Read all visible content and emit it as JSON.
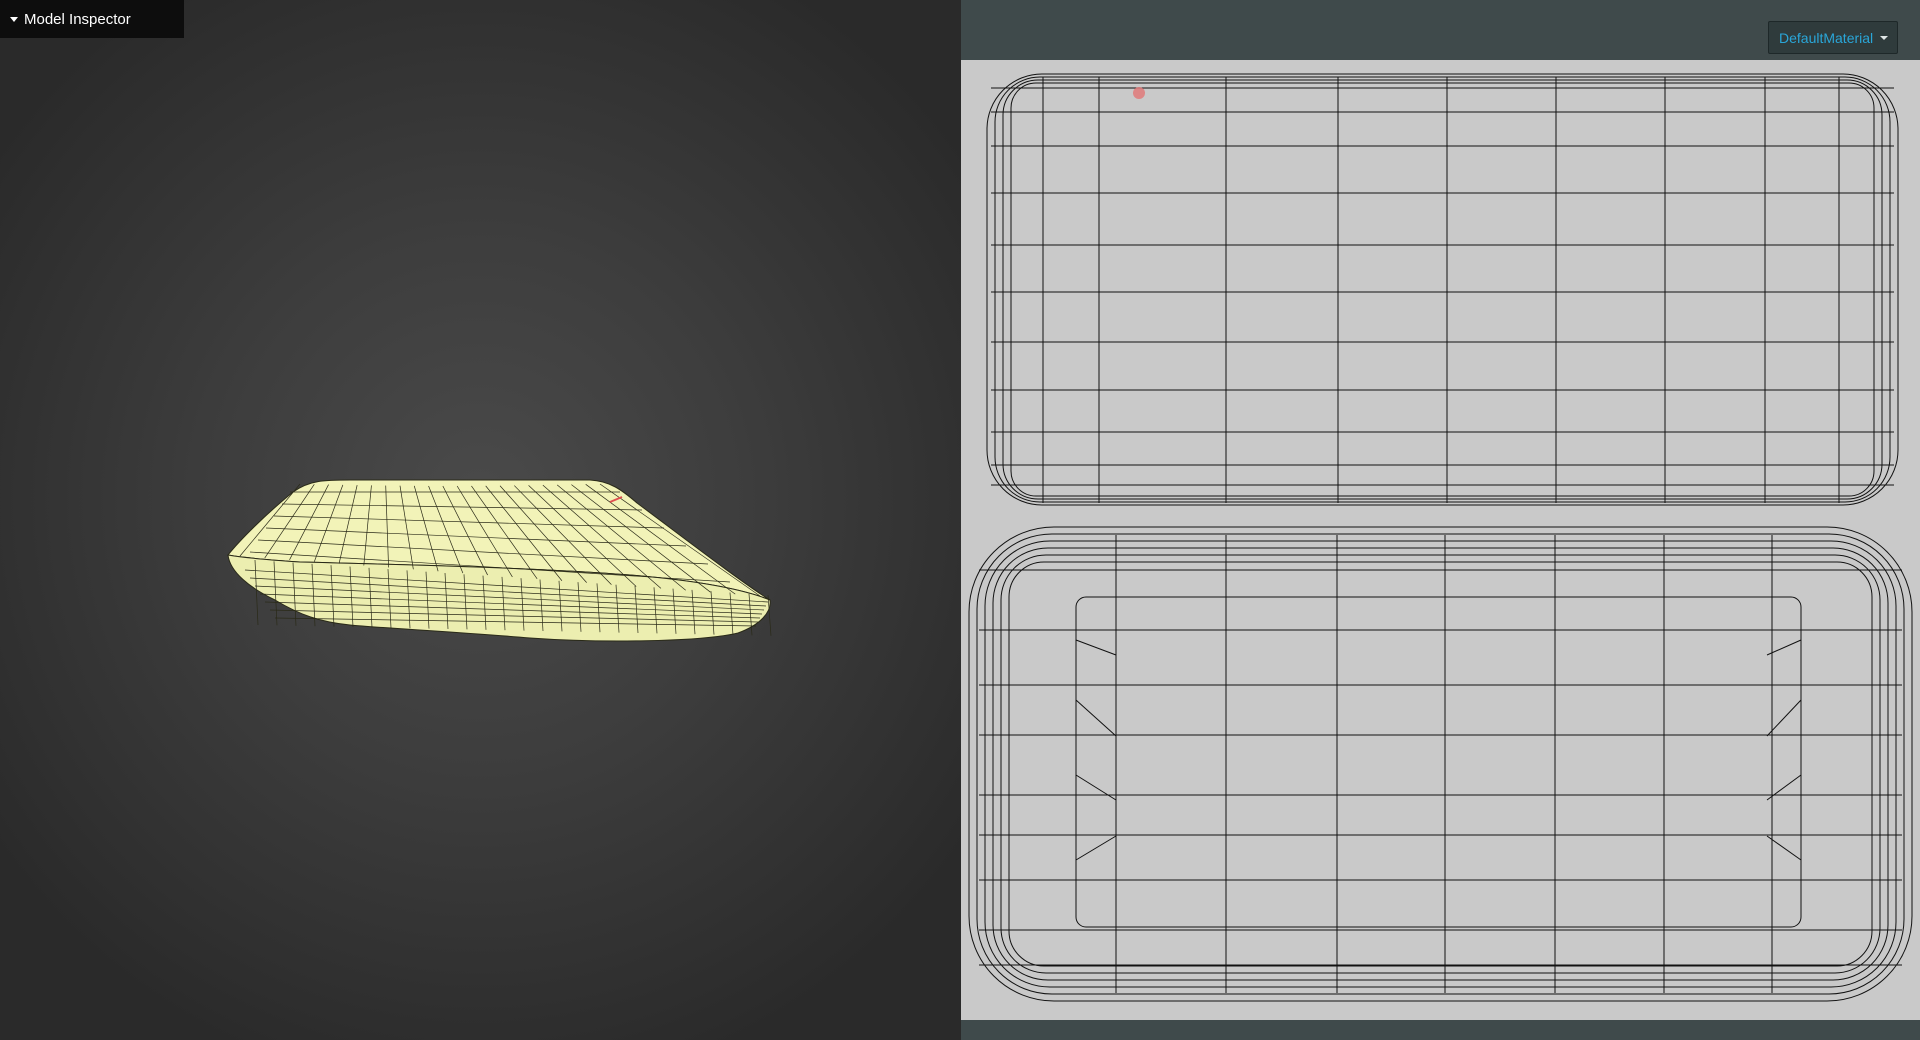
{
  "inspector": {
    "toggle_label": "Model Inspector",
    "toggle_icon": "caret-down-icon"
  },
  "uv_panel": {
    "material_selected": "DefaultMaterial",
    "material_icon": "caret-down-icon"
  },
  "colors": {
    "mesh_fill": "#f2f3b8",
    "wire": "#111111",
    "uv_background": "#c9c9c9",
    "panel_background": "#3f4a4b",
    "material_text": "#2aa6d8",
    "selection_marker": "#e07a7a"
  }
}
